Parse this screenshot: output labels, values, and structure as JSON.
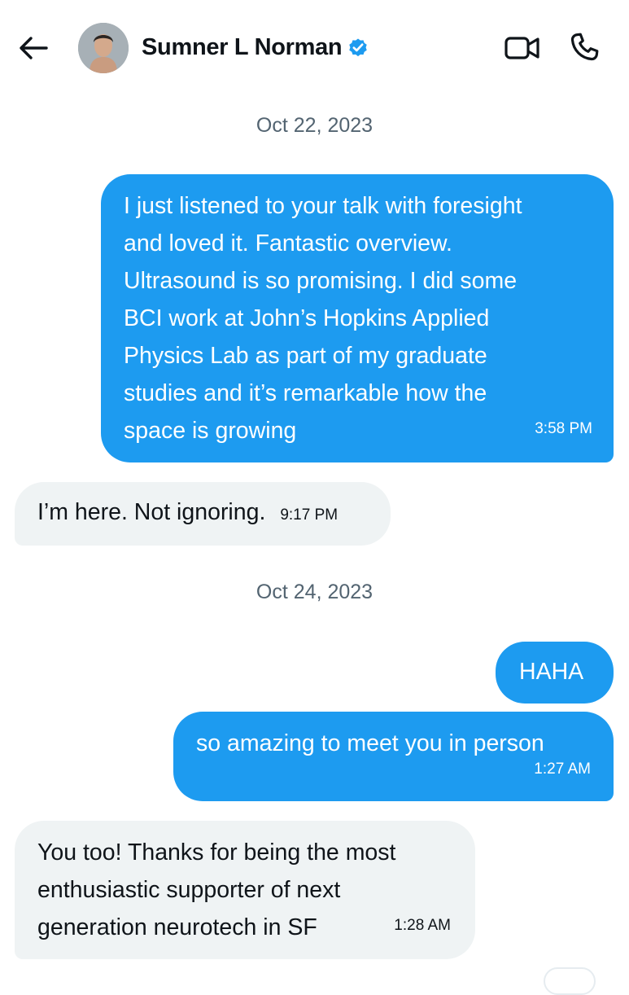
{
  "header": {
    "contact_name": "Sumner L Norman",
    "icons": {
      "back": "arrow-left-icon",
      "verified": "verified-badge-icon",
      "video": "video-call-icon",
      "phone": "phone-call-icon"
    },
    "colors": {
      "verified": "#1d9bf0"
    }
  },
  "colors": {
    "outgoing_bubble": "#1d9bf0",
    "incoming_bubble": "#eff3f4",
    "date_text": "#536471"
  },
  "conversation": [
    {
      "type": "date",
      "text": "Oct 22, 2023"
    },
    {
      "type": "message",
      "direction": "outgoing",
      "lines": [
        "I just listened to your talk with foresight",
        "and loved it. Fantastic overview.",
        "Ultrasound is so promising. I did some",
        "BCI work at John’s Hopkins Applied",
        "Physics Lab as part of my graduate",
        "studies and it’s remarkable how the",
        "space is growing"
      ],
      "time": "3:58 PM"
    },
    {
      "type": "message",
      "direction": "incoming",
      "text": "I’m here. Not ignoring.",
      "time": "9:17 PM"
    },
    {
      "type": "date",
      "text": "Oct 24, 2023"
    },
    {
      "type": "message",
      "direction": "outgoing",
      "text": "HAHA",
      "time": ""
    },
    {
      "type": "message",
      "direction": "outgoing",
      "text": "so amazing to meet you in person",
      "time": "1:27 AM"
    },
    {
      "type": "message",
      "direction": "incoming",
      "lines": [
        "You too! Thanks for being the most",
        "enthusiastic supporter of next",
        "generation neurotech in SF"
      ],
      "time": "1:28 AM"
    }
  ]
}
